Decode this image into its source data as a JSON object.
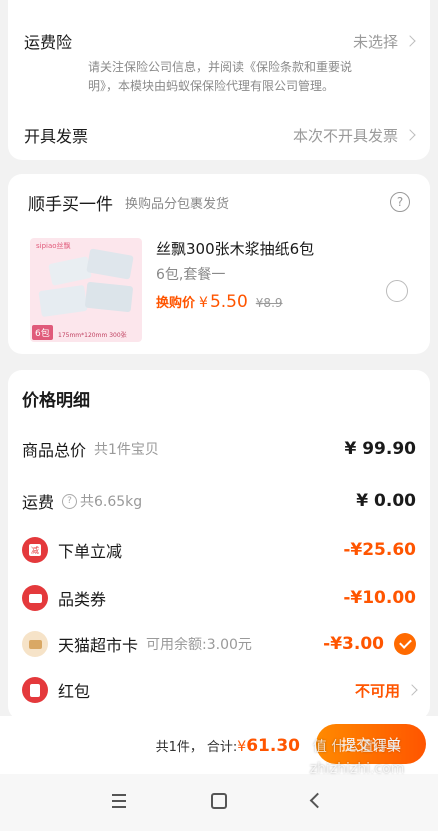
{
  "shipping_insurance": {
    "label": "运费险",
    "value": "未选择",
    "note_line1": "请关注保险公司信息，并阅读《保险条款和重要说",
    "note_line2": "明》，本模块由蚂蚁保保险代理有限公司管理。"
  },
  "invoice": {
    "label": "开具发票",
    "value": "本次不开具发票"
  },
  "add_on": {
    "title": "顺手买一件",
    "subtitle": "换购品分包裹发货",
    "help_icon": "question-circle-icon",
    "product": {
      "name": "丝飘300张木浆抽纸6包",
      "spec": "6包,套餐一",
      "price_label": "换购价",
      "currency": "¥",
      "price": "5.50",
      "original_price": "¥8.9",
      "image_brand": "sipiao丝飘",
      "image_badge": "6包",
      "image_caption": "175mm*120mm 300张"
    }
  },
  "price_detail": {
    "title": "价格明细",
    "total": {
      "label": "商品总价",
      "sub": "共1件宝贝",
      "value": "¥ 99.90"
    },
    "shipping": {
      "label": "运费",
      "sub": "共6.65kg",
      "value": "¥ 0.00"
    },
    "instant_discount": {
      "label": "下单立减",
      "value": "-¥25.60",
      "icon": "discount-icon"
    },
    "category_coupon": {
      "label": "品类券",
      "value": "-¥10.00",
      "icon": "coupon-icon"
    },
    "supermarket_card": {
      "label": "天猫超市卡",
      "sub": "可用余额:3.00元",
      "value": "-¥3.00",
      "icon": "card-icon"
    },
    "red_packet": {
      "label": "红包",
      "value": "不可用",
      "icon": "red-packet-icon"
    }
  },
  "footer": {
    "count": "共1件，",
    "total_label": "合计:",
    "currency": "¥",
    "total": "61.30",
    "submit": "提交订单"
  },
  "watermark": "值 什么值得买 zhizhizhi.com",
  "colors": {
    "accent": "#ff5500",
    "red": "#e4393c",
    "submit_bg": "#ff6a00"
  }
}
